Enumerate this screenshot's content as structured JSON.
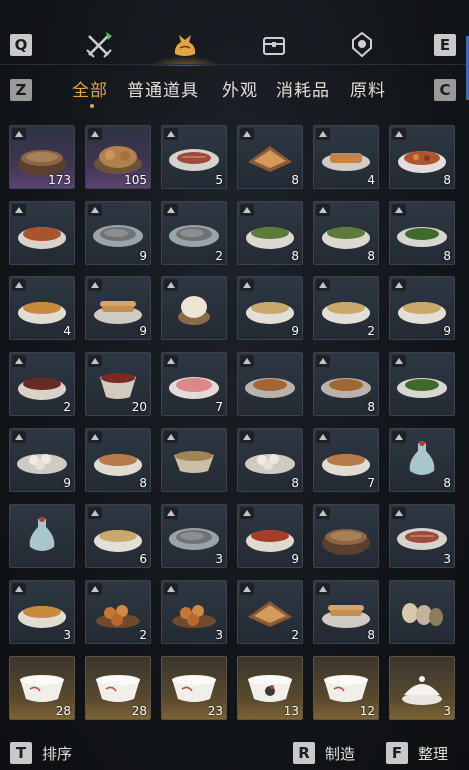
{
  "tabs": {
    "left_key": "Q",
    "right_key": "E",
    "items": [
      {
        "name": "weapons-tab",
        "icon": "crossed-swords-icon"
      },
      {
        "name": "bag-tab",
        "icon": "money-bag-icon",
        "active": true
      },
      {
        "name": "chest-tab",
        "icon": "chest-icon"
      },
      {
        "name": "gem-tab",
        "icon": "gem-icon"
      }
    ]
  },
  "categories": {
    "left_key": "Z",
    "right_key": "C",
    "items": [
      "全部",
      "普通道具",
      "外观",
      "消耗品",
      "原料"
    ],
    "active_index": 0
  },
  "items": [
    {
      "count": "173",
      "rarity": "purple",
      "food": "clay-pot-stew"
    },
    {
      "count": "105",
      "rarity": "purple",
      "food": "roast-bird"
    },
    {
      "count": "5",
      "rarity": "normal",
      "food": "sliced-meat-plate"
    },
    {
      "count": "8",
      "rarity": "normal",
      "food": "cake-tray"
    },
    {
      "count": "4",
      "rarity": "normal",
      "food": "fried-bread"
    },
    {
      "count": "8",
      "rarity": "normal",
      "food": "meat-stew"
    },
    {
      "count": "",
      "rarity": "normal",
      "food": "soup-bowl"
    },
    {
      "count": "9",
      "rarity": "normal",
      "food": "fish-plate"
    },
    {
      "count": "2",
      "rarity": "normal",
      "food": "fish-plate"
    },
    {
      "count": "8",
      "rarity": "normal",
      "food": "greens-soup"
    },
    {
      "count": "8",
      "rarity": "normal",
      "food": "greens-soup"
    },
    {
      "count": "8",
      "rarity": "normal",
      "food": "greens-plate"
    },
    {
      "count": "4",
      "rarity": "normal",
      "food": "egg-soup"
    },
    {
      "count": "9",
      "rarity": "normal",
      "food": "pancake-stack"
    },
    {
      "count": "",
      "rarity": "normal",
      "food": "steamed-bun"
    },
    {
      "count": "9",
      "rarity": "normal",
      "food": "noodle-bowl"
    },
    {
      "count": "2",
      "rarity": "normal",
      "food": "noodle-bowl"
    },
    {
      "count": "9",
      "rarity": "normal",
      "food": "noodle-bowl"
    },
    {
      "count": "2",
      "rarity": "normal",
      "food": "red-soup"
    },
    {
      "count": "20",
      "rarity": "normal",
      "food": "red-soup-cup"
    },
    {
      "count": "7",
      "rarity": "normal",
      "food": "sashimi-plate"
    },
    {
      "count": "",
      "rarity": "normal",
      "food": "braised-plate"
    },
    {
      "count": "8",
      "rarity": "normal",
      "food": "braised-plate"
    },
    {
      "count": "",
      "rarity": "normal",
      "food": "greens-plate"
    },
    {
      "count": "9",
      "rarity": "normal",
      "food": "dumpling-plate"
    },
    {
      "count": "8",
      "rarity": "normal",
      "food": "meat-bowl"
    },
    {
      "count": "",
      "rarity": "normal",
      "food": "tea-bowl"
    },
    {
      "count": "8",
      "rarity": "normal",
      "food": "dumpling-plate"
    },
    {
      "count": "7",
      "rarity": "normal",
      "food": "meat-bowl"
    },
    {
      "count": "8",
      "rarity": "normal",
      "food": "wine-vase"
    },
    {
      "count": "",
      "rarity": "normal",
      "food": "wine-vase"
    },
    {
      "count": "6",
      "rarity": "normal",
      "food": "noodle-bowl"
    },
    {
      "count": "3",
      "rarity": "normal",
      "food": "fish-plate"
    },
    {
      "count": "9",
      "rarity": "normal",
      "food": "spicy-bowl"
    },
    {
      "count": "",
      "rarity": "normal",
      "food": "clay-pot-stew"
    },
    {
      "count": "3",
      "rarity": "normal",
      "food": "sliced-meat-plate"
    },
    {
      "count": "3",
      "rarity": "normal",
      "food": "egg-soup"
    },
    {
      "count": "2",
      "rarity": "normal",
      "food": "fried-balls"
    },
    {
      "count": "3",
      "rarity": "normal",
      "food": "fried-balls"
    },
    {
      "count": "2",
      "rarity": "normal",
      "food": "cake-tray"
    },
    {
      "count": "8",
      "rarity": "normal",
      "food": "pancake-stack"
    },
    {
      "count": "",
      "rarity": "normal",
      "food": "eggs"
    },
    {
      "count": "28",
      "rarity": "gold",
      "food": "porcelain-bowl"
    },
    {
      "count": "28",
      "rarity": "gold",
      "food": "porcelain-bowl"
    },
    {
      "count": "23",
      "rarity": "gold",
      "food": "porcelain-bowl"
    },
    {
      "count": "13",
      "rarity": "gold",
      "food": "rooster-bowl"
    },
    {
      "count": "12",
      "rarity": "gold",
      "food": "porcelain-bowl"
    },
    {
      "count": "3",
      "rarity": "gold",
      "food": "covered-bowl"
    }
  ],
  "tagged_slots": [
    0,
    1,
    2,
    3,
    4,
    5,
    6,
    7,
    8,
    9,
    10,
    11,
    12,
    13,
    14,
    15,
    16,
    17,
    18,
    19,
    20,
    21,
    22,
    23,
    24,
    25,
    26,
    27,
    28,
    29,
    31,
    32,
    33,
    34,
    35,
    36,
    37,
    38,
    39,
    40
  ],
  "bottom": {
    "sort_key": "T",
    "sort_label": "排序",
    "craft_key": "R",
    "craft_label": "制造",
    "organize_key": "F",
    "organize_label": "整理"
  }
}
